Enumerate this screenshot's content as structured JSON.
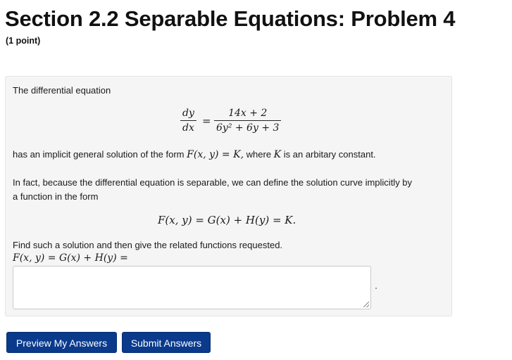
{
  "page": {
    "title": "Section 2.2 Separable Equations: Problem 4",
    "points": "(1 point)"
  },
  "problem": {
    "intro": "The differential equation",
    "ode": {
      "lhs_num": "dy",
      "lhs_den": "dx",
      "eq": "=",
      "rhs_num": "14x + 2",
      "rhs_den": "6y² + 6y + 3"
    },
    "implicit_line": {
      "prefix": "has an implicit general solution of the form ",
      "F": "F(x, y) = K,",
      "middle": " where ",
      "K": "K",
      "suffix": " is an arbitary constant."
    },
    "separable_text_1": "In fact, because the differential equation is separable, we can define the solution curve implicitly by",
    "separable_text_2": "a function in the form",
    "form_equation": "F(x, y) = G(x) + H(y) = K.",
    "find_text": "Find such a solution and then give the related functions requested.",
    "answer_label": "F(x, y) = G(x) + H(y) =",
    "answer_value": ""
  },
  "buttons": {
    "preview": "Preview My Answers",
    "submit": "Submit Answers"
  }
}
